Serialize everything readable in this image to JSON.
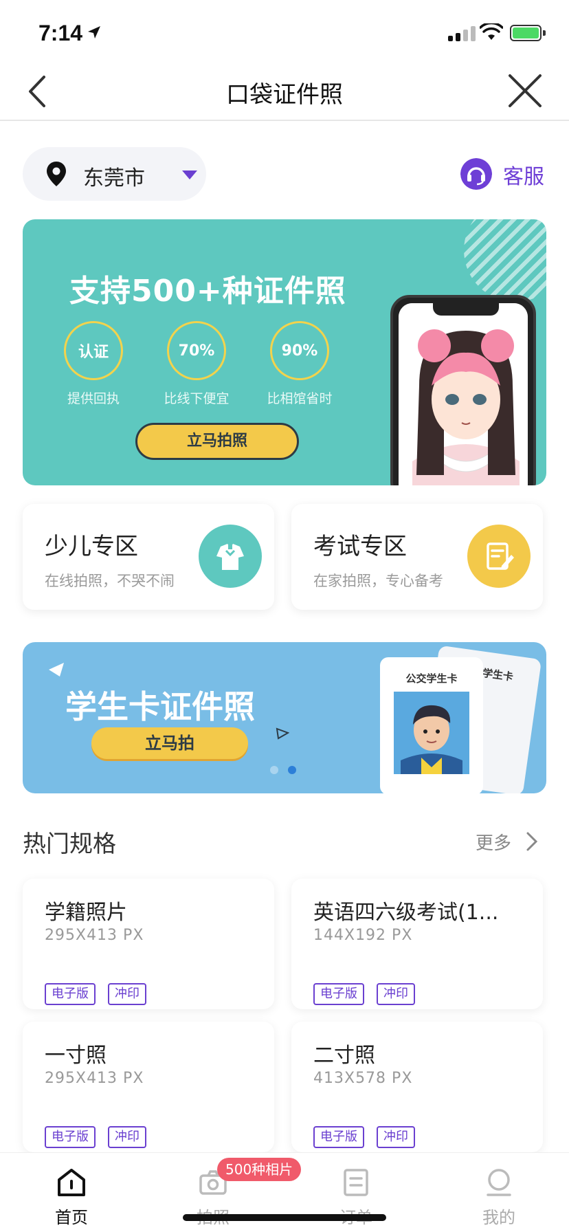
{
  "status_bar": {
    "time": "7:14"
  },
  "nav": {
    "title": "口袋证件照"
  },
  "location": {
    "city": "东莞市"
  },
  "service": {
    "label": "客服"
  },
  "banner_main": {
    "headline": "支持500+种证件照",
    "features": [
      {
        "value": "认证",
        "caption": "提供回执"
      },
      {
        "value": "70%",
        "caption": "比线下便宜"
      },
      {
        "value": "90%",
        "caption": "比相馆省时"
      }
    ],
    "cta": "立马拍照"
  },
  "zones": [
    {
      "title": "少儿专区",
      "subtitle": "在线拍照，不哭不闹",
      "color": "#5ec8bf"
    },
    {
      "title": "考试专区",
      "subtitle": "在家拍照，专心备考",
      "color": "#f3c94a"
    }
  ],
  "banner_student": {
    "headline": "学生卡证件照",
    "cta": "立马拍",
    "card_title": "公交学生卡",
    "card_title_back": "公交学生卡"
  },
  "hot_specs": {
    "title": "热门规格",
    "more": "更多",
    "items": [
      {
        "name": "学籍照片",
        "size": "295X413 PX",
        "tags": [
          "电子版",
          "冲印"
        ]
      },
      {
        "name": "英语四六级考试(1...",
        "size": "144X192 PX",
        "tags": [
          "电子版",
          "冲印"
        ]
      },
      {
        "name": "一寸照",
        "size": "295X413 PX",
        "tags": [
          "电子版",
          "冲印"
        ]
      },
      {
        "name": "二寸照",
        "size": "413X578 PX",
        "tags": [
          "电子版",
          "冲印"
        ]
      }
    ]
  },
  "tabbar": {
    "promo": "500种相片",
    "tabs": [
      {
        "label": "首页",
        "icon": "home-icon",
        "active": true
      },
      {
        "label": "拍照",
        "icon": "camera-icon",
        "active": false
      },
      {
        "label": "订单",
        "icon": "order-icon",
        "active": false
      },
      {
        "label": "我的",
        "icon": "profile-icon",
        "active": false
      }
    ]
  },
  "colors": {
    "accent": "#6e3fd6",
    "teal": "#5ec8bf",
    "sky": "#79bde6",
    "yellow": "#f3c94a",
    "promo": "#f05a6a"
  }
}
